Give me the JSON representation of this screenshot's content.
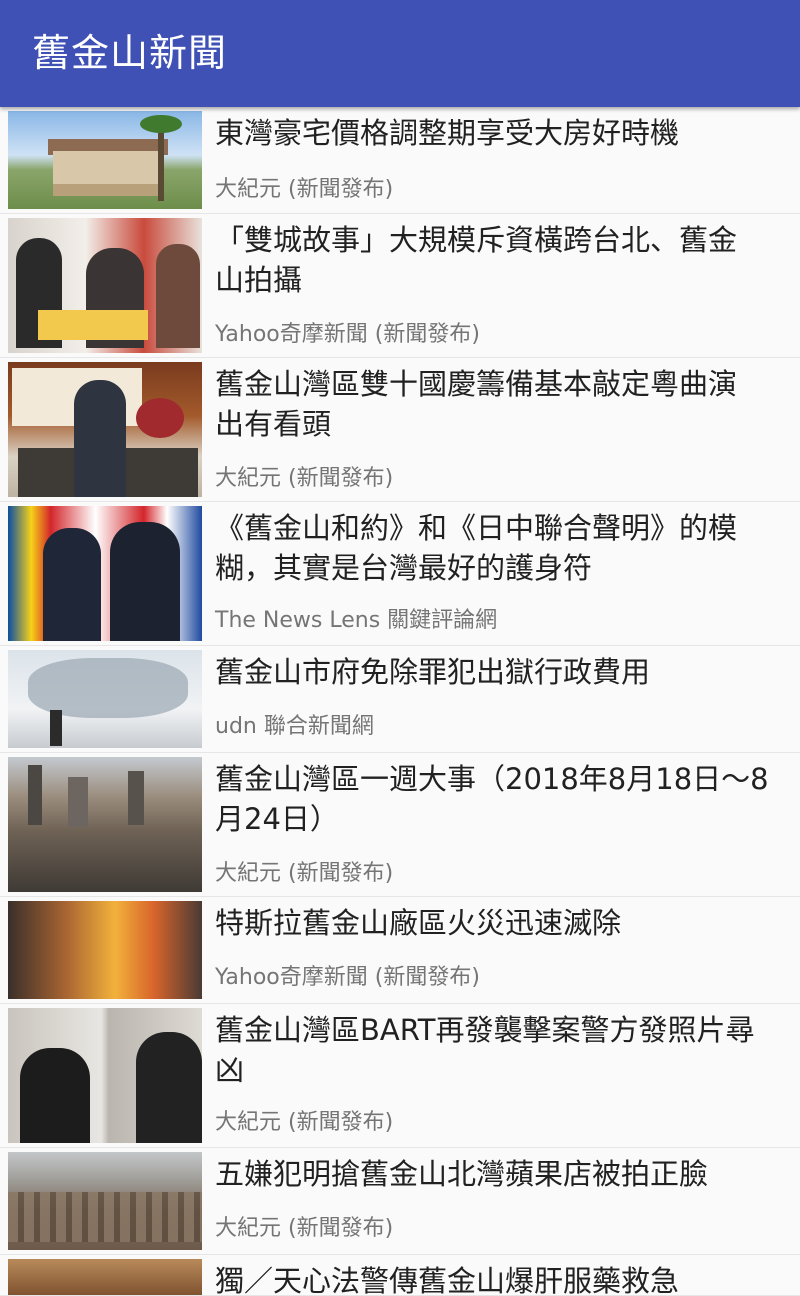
{
  "app": {
    "title": "舊金山新聞"
  },
  "colors": {
    "appbar": "#3f51b5",
    "background": "#fafafa"
  },
  "news": [
    {
      "headline": "東灣豪宅價格調整期享受大房好時機",
      "source": "大紀元 (新聞發布)"
    },
    {
      "headline": "「雙城故事」大規模斥資橫跨台北、舊金\n山拍攝",
      "source": "Yahoo奇摩新聞 (新聞發布)"
    },
    {
      "headline": "舊金山灣區雙十國慶籌備基本敲定粵曲演\n出有看頭",
      "source": "大紀元 (新聞發布)"
    },
    {
      "headline": "《舊金山和約》和《日中聯合聲明》的模\n糊，其實是台灣最好的護身符",
      "source": "The News Lens 關鍵評論網"
    },
    {
      "headline": "舊金山市府免除罪犯出獄行政費用",
      "source": "udn 聯合新聞網"
    },
    {
      "headline": "舊金山灣區一週大事（2018年8月18日～8\n月24日）",
      "source": "大紀元 (新聞發布)"
    },
    {
      "headline": "特斯拉舊金山廠區火災迅速滅除",
      "source": "Yahoo奇摩新聞 (新聞發布)"
    },
    {
      "headline": "舊金山灣區BART再發襲擊案警方發照片尋\n凶",
      "source": "大紀元 (新聞發布)"
    },
    {
      "headline": "五嫌犯明搶舊金山北灣蘋果店被拍正臉",
      "source": "大紀元 (新聞發布)"
    },
    {
      "headline": "獨／天心法警傳舊金山爆肝服藥救急",
      "source": ""
    }
  ]
}
